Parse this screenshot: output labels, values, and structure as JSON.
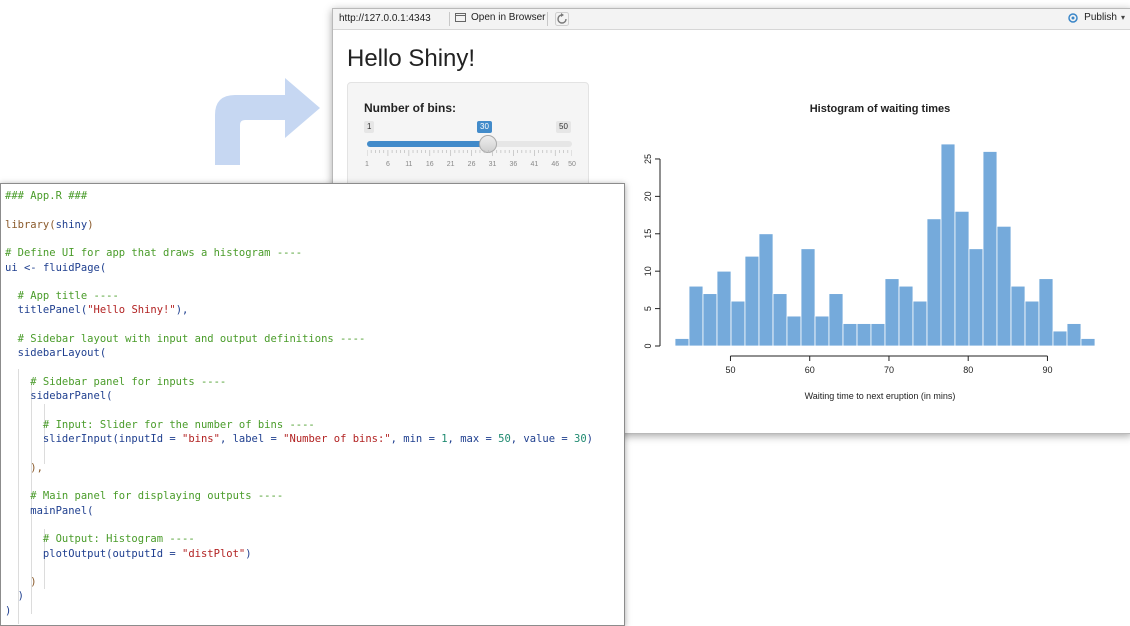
{
  "browser": {
    "url": "http://127.0.0.1:4343",
    "open_in_browser_label": "Open in Browser",
    "publish_label": "Publish"
  },
  "app": {
    "title": "Hello Shiny!",
    "slider": {
      "label": "Number of bins:",
      "min": 1,
      "max": 50,
      "value": 30,
      "min_label": "1",
      "max_label": "50",
      "value_label": "30",
      "tick_labels": [
        "1",
        "6",
        "11",
        "16",
        "21",
        "26",
        "31",
        "36",
        "41",
        "46",
        "50"
      ]
    }
  },
  "chart_data": {
    "type": "bar",
    "title": "Histogram of waiting times",
    "xlabel": "Waiting time to next eruption (in mins)",
    "ylabel": "",
    "x_ticks": [
      50,
      60,
      70,
      80,
      90
    ],
    "y_ticks": [
      0,
      5,
      10,
      15,
      20,
      25
    ],
    "xlim": [
      43,
      96
    ],
    "ylim": [
      0,
      27
    ],
    "bar_color": "#75aadb",
    "bins": [
      {
        "from": 43.0,
        "to": 44.77,
        "count": 1
      },
      {
        "from": 44.77,
        "to": 46.53,
        "count": 8
      },
      {
        "from": 46.53,
        "to": 48.3,
        "count": 7
      },
      {
        "from": 48.3,
        "to": 50.07,
        "count": 10
      },
      {
        "from": 50.07,
        "to": 51.83,
        "count": 6
      },
      {
        "from": 51.83,
        "to": 53.6,
        "count": 12
      },
      {
        "from": 53.6,
        "to": 55.37,
        "count": 15
      },
      {
        "from": 55.37,
        "to": 57.13,
        "count": 7
      },
      {
        "from": 57.13,
        "to": 58.9,
        "count": 4
      },
      {
        "from": 58.9,
        "to": 60.67,
        "count": 13
      },
      {
        "from": 60.67,
        "to": 62.43,
        "count": 4
      },
      {
        "from": 62.43,
        "to": 64.2,
        "count": 7
      },
      {
        "from": 64.2,
        "to": 65.97,
        "count": 3
      },
      {
        "from": 65.97,
        "to": 67.73,
        "count": 3
      },
      {
        "from": 67.73,
        "to": 69.5,
        "count": 3
      },
      {
        "from": 69.5,
        "to": 71.27,
        "count": 9
      },
      {
        "from": 71.27,
        "to": 73.03,
        "count": 8
      },
      {
        "from": 73.03,
        "to": 74.8,
        "count": 6
      },
      {
        "from": 74.8,
        "to": 76.57,
        "count": 17
      },
      {
        "from": 76.57,
        "to": 78.33,
        "count": 27
      },
      {
        "from": 78.33,
        "to": 80.1,
        "count": 18
      },
      {
        "from": 80.1,
        "to": 81.87,
        "count": 13
      },
      {
        "from": 81.87,
        "to": 83.63,
        "count": 26
      },
      {
        "from": 83.63,
        "to": 85.4,
        "count": 16
      },
      {
        "from": 85.4,
        "to": 87.17,
        "count": 8
      },
      {
        "from": 87.17,
        "to": 88.93,
        "count": 6
      },
      {
        "from": 88.93,
        "to": 90.7,
        "count": 9
      },
      {
        "from": 90.7,
        "to": 92.47,
        "count": 2
      },
      {
        "from": 92.47,
        "to": 94.23,
        "count": 3
      },
      {
        "from": 94.23,
        "to": 96.0,
        "count": 1
      }
    ]
  },
  "code": {
    "lines": [
      [
        {
          "t": "### App.R ###",
          "c": "c-comment"
        }
      ],
      [],
      [
        {
          "t": "library(",
          "c": "c-lib"
        },
        {
          "t": "shiny",
          "c": "c-var"
        },
        {
          "t": ")",
          "c": "c-lib"
        }
      ],
      [],
      [
        {
          "t": "# Define UI for app that draws a histogram ----",
          "c": "c-comment"
        }
      ],
      [
        {
          "t": "ui <- ",
          "c": "c-kw"
        },
        {
          "t": "fluidPage(",
          "c": "c-func"
        }
      ],
      [],
      [
        {
          "t": "  # App title ----",
          "c": "c-comment"
        }
      ],
      [
        {
          "t": "  titlePanel(",
          "c": "c-func"
        },
        {
          "t": "\"Hello Shiny!\"",
          "c": "c-str"
        },
        {
          "t": "),",
          "c": "c-func"
        }
      ],
      [],
      [
        {
          "t": "  # Sidebar layout with input and output definitions ----",
          "c": "c-comment"
        }
      ],
      [
        {
          "t": "  sidebarLayout(",
          "c": "c-func"
        }
      ],
      [],
      [
        {
          "t": "    # Sidebar panel for inputs ----",
          "c": "c-comment"
        }
      ],
      [
        {
          "t": "    sidebarPanel(",
          "c": "c-func"
        }
      ],
      [],
      [
        {
          "t": "      # Input: Slider for the number of bins ----",
          "c": "c-comment"
        }
      ],
      [
        {
          "t": "      sliderInput(inputId = ",
          "c": "c-func"
        },
        {
          "t": "\"bins\"",
          "c": "c-str"
        },
        {
          "t": ", label = ",
          "c": "c-func"
        },
        {
          "t": "\"Number of bins:\"",
          "c": "c-str"
        },
        {
          "t": ", min = ",
          "c": "c-func"
        },
        {
          "t": "1",
          "c": "c-num"
        },
        {
          "t": ", max = ",
          "c": "c-func"
        },
        {
          "t": "50",
          "c": "c-num"
        },
        {
          "t": ", value = ",
          "c": "c-func"
        },
        {
          "t": "30",
          "c": "c-num"
        },
        {
          "t": ")",
          "c": "c-func"
        }
      ],
      [],
      [
        {
          "t": "    ),",
          "c": "c-lib"
        }
      ],
      [],
      [
        {
          "t": "    # Main panel for displaying outputs ----",
          "c": "c-comment"
        }
      ],
      [
        {
          "t": "    mainPanel(",
          "c": "c-func"
        }
      ],
      [],
      [
        {
          "t": "      # Output: Histogram ----",
          "c": "c-comment"
        }
      ],
      [
        {
          "t": "      plotOutput(outputId = ",
          "c": "c-func"
        },
        {
          "t": "\"distPlot\"",
          "c": "c-str"
        },
        {
          "t": ")",
          "c": "c-func"
        }
      ],
      [],
      [
        {
          "t": "    )",
          "c": "c-lib"
        }
      ],
      [
        {
          "t": "  )",
          "c": "c-func"
        }
      ],
      [
        {
          "t": ")",
          "c": "c-func"
        }
      ]
    ]
  }
}
